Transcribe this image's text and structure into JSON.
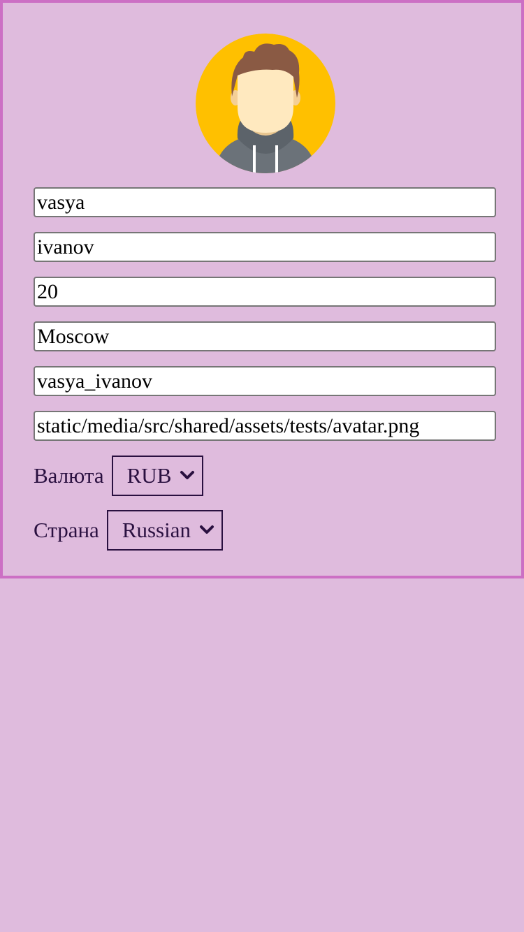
{
  "profile": {
    "avatar_icon": "user-avatar-icon",
    "fields": {
      "first_name": "vasya",
      "last_name": "ivanov",
      "age": "20",
      "city": "Moscow",
      "username": "vasya_ivanov",
      "avatar": "static/media/src/shared/assets/tests/avatar.png"
    },
    "currency": {
      "label": "Валюта",
      "selected": "RUB"
    },
    "country": {
      "label": "Страна",
      "selected": "Russian"
    }
  },
  "colors": {
    "background": "#dfbbdd",
    "border": "#cc6fc4",
    "text": "#2a1040",
    "avatar_bg": "#ffc000"
  }
}
